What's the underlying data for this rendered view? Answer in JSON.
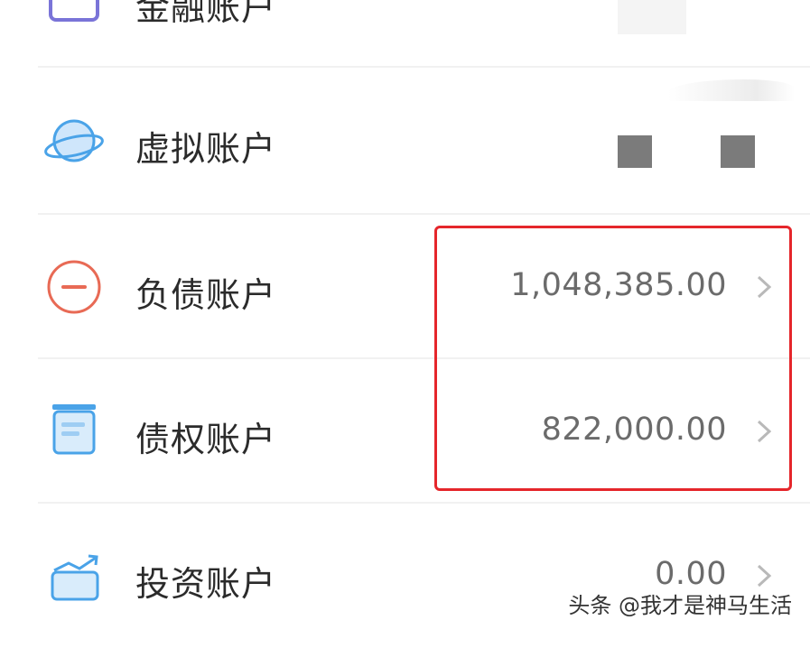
{
  "accounts": [
    {
      "label": "金融账户",
      "value": "",
      "icon": "finance-card-icon"
    },
    {
      "label": "虚拟账户",
      "value": "",
      "icon": "planet-icon"
    },
    {
      "label": "负债账户",
      "value": "1,048,385.00",
      "icon": "minus-circle-icon"
    },
    {
      "label": "债权账户",
      "value": "822,000.00",
      "icon": "ledger-box-icon"
    },
    {
      "label": "投资账户",
      "value": "0.00",
      "icon": "trend-folder-icon"
    }
  ],
  "watermark": "头条 @我才是神马生活",
  "colors": {
    "highlight": "#e5262b",
    "debt_icon": "#e86a55",
    "blue_icon": "#4aa3e8",
    "value_text": "#6b6b6b"
  }
}
